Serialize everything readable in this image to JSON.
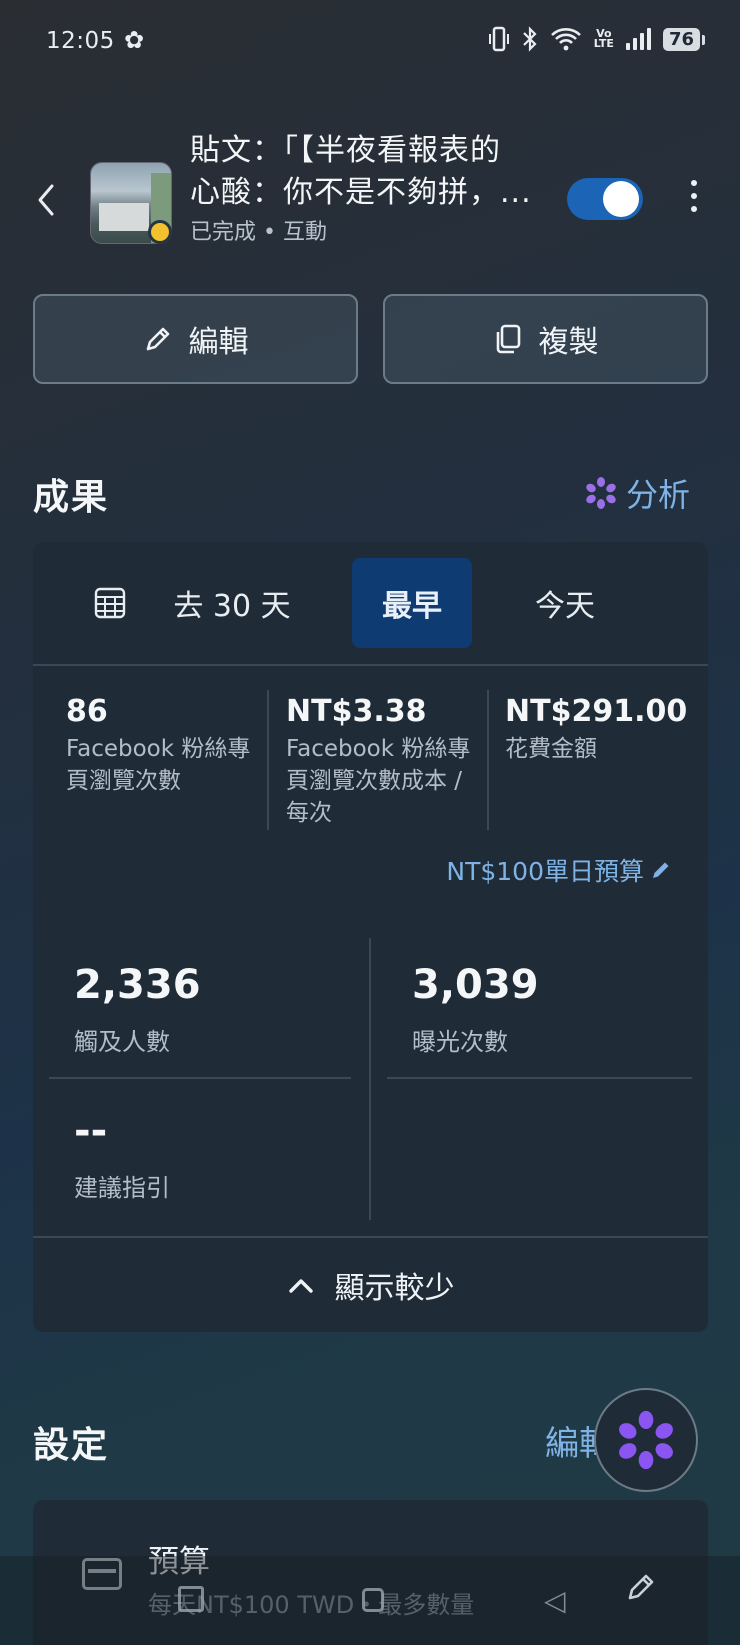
{
  "status_bar": {
    "time": "12:05",
    "network": "Vo LTE",
    "battery": "76"
  },
  "header": {
    "title": "貼文：「【半夜看報表的心酸：你不是不夠拼，...",
    "title_line1": "貼文：「【半夜看報表的",
    "title_line2": "心酸：你不是不夠拼，...",
    "subtitle": "已完成 • 互動",
    "toggle_on": true
  },
  "actions": {
    "edit_label": "編輯",
    "copy_label": "複製"
  },
  "results": {
    "title": "成果",
    "analyze_label": "分析",
    "date_tabs": [
      {
        "label": "去 30 天",
        "active": false
      },
      {
        "label": "最早",
        "active": true
      },
      {
        "label": "今天",
        "active": false
      }
    ],
    "metrics": [
      {
        "value": "86",
        "label": "Facebook 粉絲專頁瀏覽次數"
      },
      {
        "value": "NT$3.38",
        "label": "Facebook 粉絲專頁瀏覽次數成本 / 每次"
      },
      {
        "value": "NT$291.00",
        "label": "花費金額"
      }
    ],
    "daily_budget": "NT$100單日預算",
    "stats": [
      {
        "value": "2,336",
        "label": "觸及人數"
      },
      {
        "value": "3,039",
        "label": "曝光次數"
      },
      {
        "value": "--",
        "label": "建議指引"
      }
    ],
    "show_less_label": "顯示較少"
  },
  "settings": {
    "title": "設定",
    "edit_label": "編輯",
    "budget_title": "預算",
    "budget_sub": "每天NT$100 TWD・最多數量"
  },
  "colors": {
    "accent": "#7fb2e5",
    "active_tab": "#0f3b73",
    "card": "#1f2c38",
    "toggle": "#1c64b6",
    "status_dot": "#f2c12e"
  }
}
